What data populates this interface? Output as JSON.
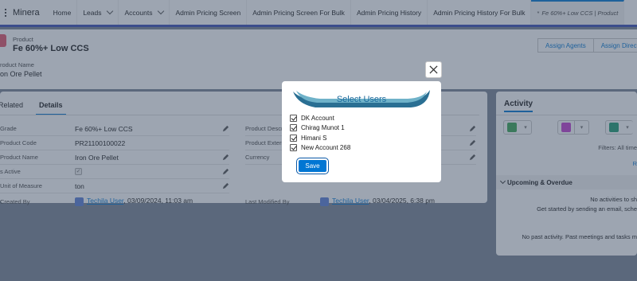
{
  "app": {
    "name": "Minera"
  },
  "nav": {
    "items": [
      {
        "label": "Home",
        "has_menu": false
      },
      {
        "label": "Leads",
        "has_menu": true
      },
      {
        "label": "Accounts",
        "has_menu": true
      },
      {
        "label": "Admin Pricing Screen",
        "has_menu": false
      },
      {
        "label": "Admin Pricing Screen For Bulk",
        "has_menu": false
      },
      {
        "label": "Admin Pricing History",
        "has_menu": false
      },
      {
        "label": "Admin Pricing History For Bulk",
        "has_menu": false
      }
    ],
    "active_tab": {
      "marker": "*",
      "label": "Fe 60%+ Low CCS | Product"
    }
  },
  "record": {
    "object_label": "Product",
    "title": "Fe 60%+ Low CCS",
    "buttons": [
      "Assign Agents",
      "Assign Direct"
    ],
    "highlight_label": "roduct Name",
    "highlight_value": "on Ore Pellet"
  },
  "tabs": [
    "Related",
    "Details"
  ],
  "details": {
    "left": [
      {
        "label": "Grade",
        "value": "Fe 60%+ Low CCS"
      },
      {
        "label": "Product Code",
        "value": "PR21100100022"
      },
      {
        "label": "Product Name",
        "value": "Iron Ore Pellet"
      },
      {
        "label": "s Active",
        "value": ""
      },
      {
        "label": "Unit of Measure",
        "value": "ton"
      },
      {
        "label": "Created By",
        "user": "Techila User",
        "date": ", 03/09/2024, 11:03 am"
      }
    ],
    "right": [
      {
        "label": "Product Descr"
      },
      {
        "label": "Product Extern"
      },
      {
        "label": "Currency"
      },
      {
        "label": "Last Modified By",
        "user": "Techila User",
        "date": ", 03/04/2025, 6:38 pm"
      }
    ]
  },
  "activity": {
    "title": "Activity",
    "filters": "Filters: All time",
    "refresh": "R",
    "upcoming": "Upcoming & Overdue",
    "no_activities": "No activities to sh",
    "get_started": "Get started by sending an email, sche",
    "no_past": "No past activity. Past meetings and tasks m",
    "icon_colors": [
      "#3ba755",
      "#c23fd0",
      "#1e9c73"
    ]
  },
  "modal": {
    "title": "Select Users",
    "users": [
      {
        "name": "DK Account",
        "checked": true
      },
      {
        "name": "Chirag Munot 1",
        "checked": true
      },
      {
        "name": "Himani S",
        "checked": true
      },
      {
        "name": "New Account 268",
        "checked": true
      }
    ],
    "save_label": "Save"
  },
  "colors": {
    "brand": "#0176d3",
    "nav_border": "#3b4fb4",
    "modal_title": "#1b6a9c"
  }
}
